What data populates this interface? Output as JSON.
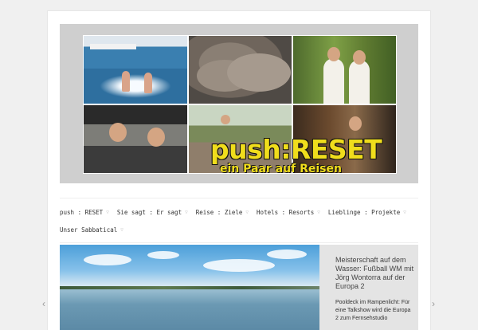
{
  "banner": {
    "title": "push:RESET",
    "subtitle": "ein Paar auf Reisen"
  },
  "nav": {
    "row1": [
      "push : RESET",
      "Sie sagt : Er sagt",
      "Reise : Ziele",
      "Hotels : Resorts",
      "Lieblinge : Projekte"
    ],
    "row2": [
      "Unser Sabbatical"
    ],
    "chevron_icon": "chevron-down-icon"
  },
  "feature": {
    "headline": "Meisterschaft auf dem Wasser: Fußball WM mit Jörg Wontorra auf der Europa 2",
    "excerpt": "Pooldeck im Rampenlicht: Für eine Talkshow wird die Europa 2 zum Fernsehstudio"
  },
  "slider": {
    "prev_glyph": "‹",
    "next_glyph": "›"
  },
  "colors": {
    "banner_text": "#f0dd1c",
    "header_bg": "#cfcfcf",
    "side_panel_bg": "#e4e4e4"
  }
}
